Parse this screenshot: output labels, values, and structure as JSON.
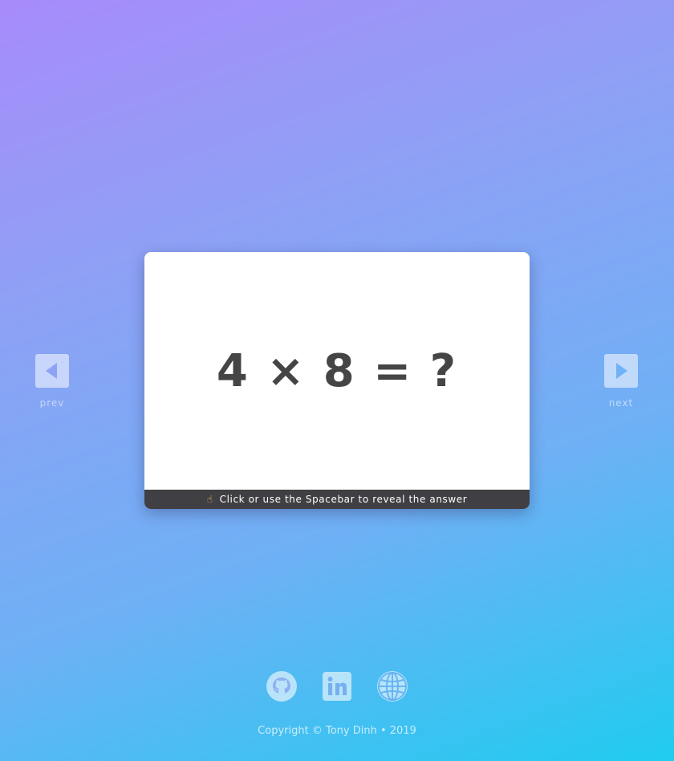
{
  "flashcard": {
    "question": "4 × 8 = ?",
    "hint_icon": "pointing-finger-icon",
    "hint": "Click or use the Spacebar to reveal the answer"
  },
  "nav": {
    "prev_label": "prev",
    "next_label": "next"
  },
  "social": [
    {
      "icon": "github-icon"
    },
    {
      "icon": "linkedin-icon"
    },
    {
      "icon": "globe-icon"
    }
  ],
  "footer": {
    "copyright": "Copyright © Tony Dinh • 2019"
  },
  "colors": {
    "card_text": "#454545",
    "hint_bar": "#3f3f44",
    "gradient_start": "#a78bfa",
    "gradient_end": "#20ccf0"
  }
}
